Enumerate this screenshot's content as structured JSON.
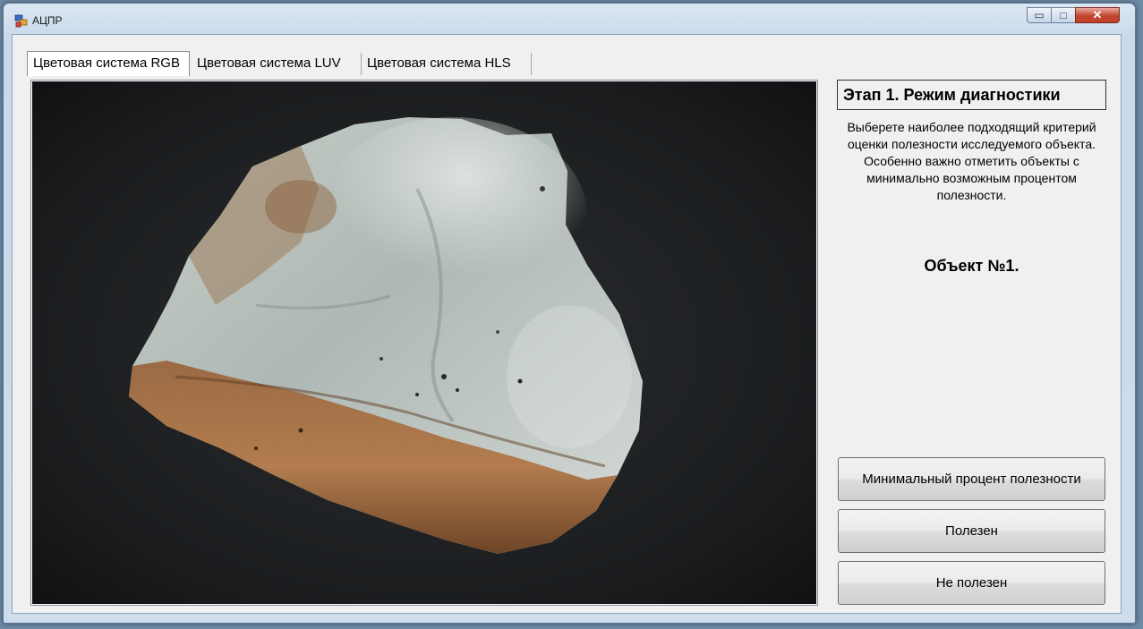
{
  "window": {
    "title": "АЦПР",
    "controls": {
      "minimize": "▭",
      "maximize": "□",
      "close": "✕"
    }
  },
  "tabs": [
    {
      "label": "Цветовая система RGB",
      "active": true
    },
    {
      "label": "Цветовая система LUV",
      "active": false
    },
    {
      "label": "Цветовая система HLS",
      "active": false
    }
  ],
  "panel": {
    "stage_title": "Этап 1. Режим диагностики",
    "instructions": "Выберете наиболее подходящий критерий оценки полезности исследуемого объекта. Особенно важно отметить объекты с минимально возможным процентом полезности.",
    "object_label": "Объект №1."
  },
  "buttons": {
    "min_percent": "Минимальный процент полезности",
    "useful": "Полезен",
    "not_useful": "Не полезен"
  },
  "image": {
    "subject": "rock-sample-photo"
  }
}
